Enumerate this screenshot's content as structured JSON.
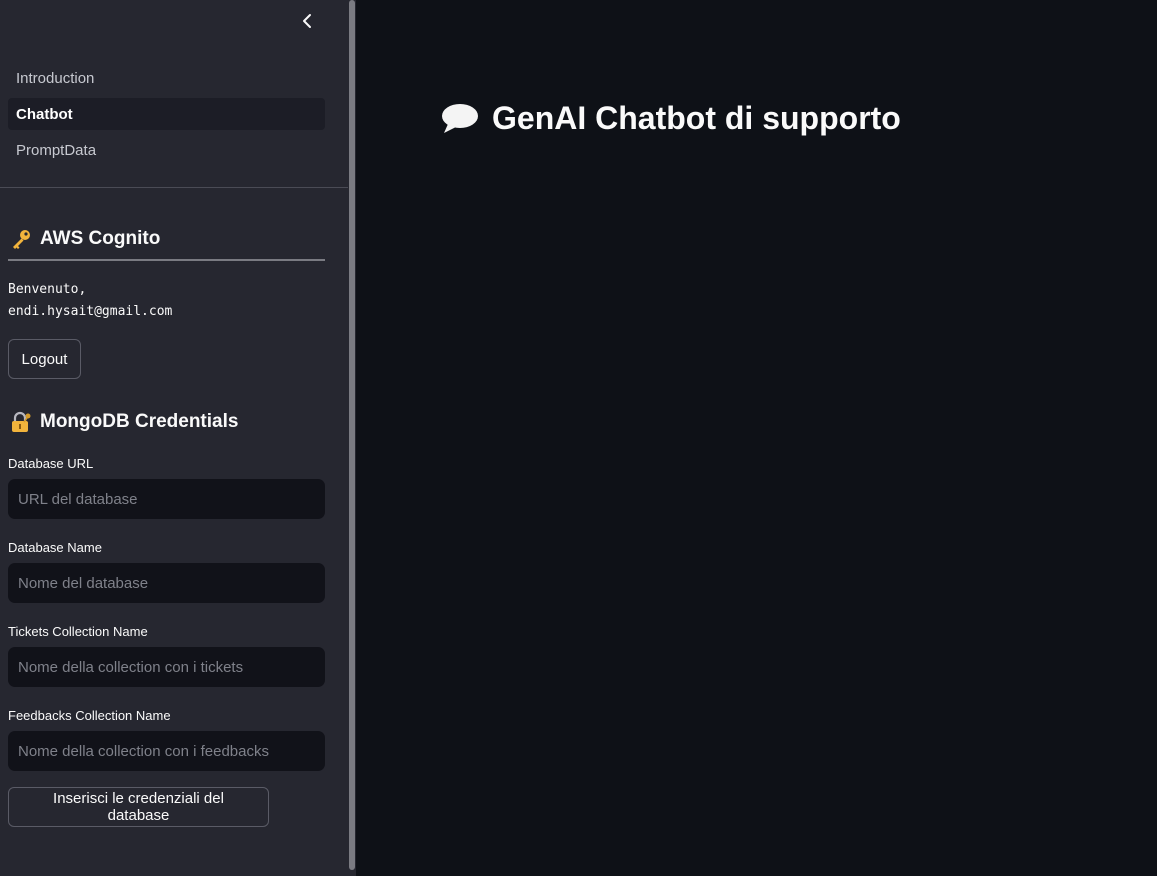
{
  "sidebar": {
    "nav": [
      {
        "label": "Introduction",
        "active": false
      },
      {
        "label": "Chatbot",
        "active": true
      },
      {
        "label": "PromptData",
        "active": false
      }
    ],
    "cognito": {
      "title": "AWS Cognito",
      "icon": "key-icon",
      "welcome_line1": "Benvenuto,",
      "welcome_line2": "endi.hysait@gmail.com",
      "logout_label": "Logout"
    },
    "mongo": {
      "title": "MongoDB Credentials",
      "icon": "lock-with-key-icon",
      "fields": [
        {
          "label": "Database URL",
          "placeholder": "URL del database",
          "value": ""
        },
        {
          "label": "Database Name",
          "placeholder": "Nome del database",
          "value": ""
        },
        {
          "label": "Tickets Collection Name",
          "placeholder": "Nome della collection con i tickets",
          "value": ""
        },
        {
          "label": "Feedbacks Collection Name",
          "placeholder": "Nome della collection con i feedbacks",
          "value": ""
        }
      ],
      "submit_label": "Inserisci le credenziali del database"
    }
  },
  "main": {
    "title": "GenAI Chatbot di supporto",
    "title_icon": "speech-bubble-icon"
  },
  "colors": {
    "main_bg": "#0e1117",
    "sidebar_bg": "#262730",
    "input_bg": "#111219",
    "text": "#fafafa",
    "key_icon": "#f2b43c"
  }
}
